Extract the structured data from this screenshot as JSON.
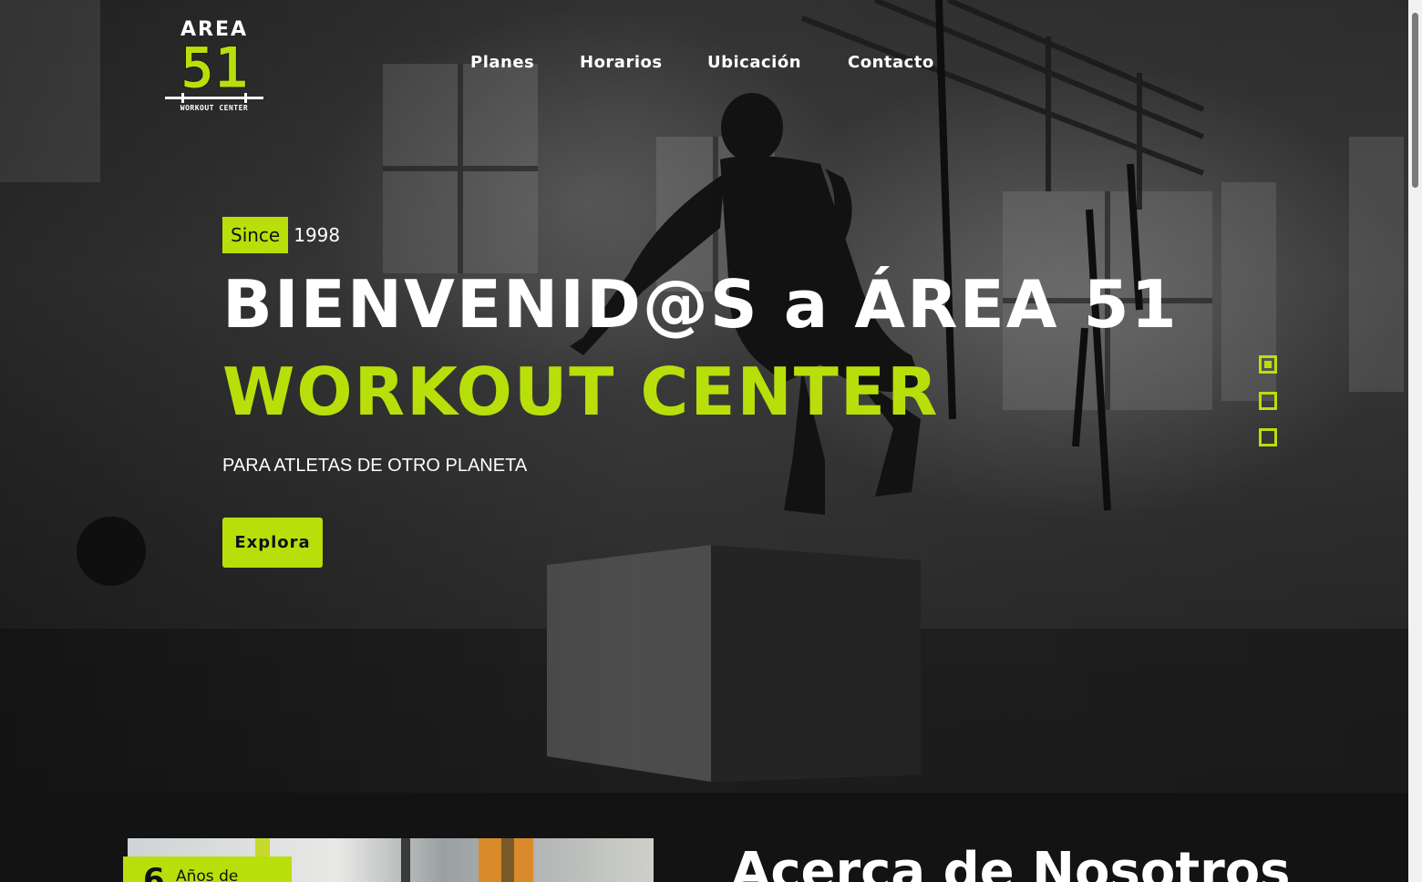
{
  "brand": {
    "logo_top": "AREA",
    "logo_number": "51",
    "logo_sub": "WORKOUT CENTER"
  },
  "nav": {
    "items": [
      "Planes",
      "Horarios",
      "Ubicación",
      "Contacto"
    ]
  },
  "hero": {
    "since_label": "Since",
    "since_year": "1998",
    "title_line1": "BIENVENID@S a ÁREA 51",
    "title_line2": "WORKOUT CENTER",
    "tagline": "PARA ATLETAS DE OTRO PLANETA",
    "cta_label": "Explora",
    "slides": {
      "count": 3,
      "active_index": 0
    }
  },
  "about": {
    "years_number": "6",
    "years_label": "Años de",
    "title": "Acerca de Nosotros"
  },
  "colors": {
    "accent": "#b9df0b",
    "dark": "#131313",
    "text": "#ffffff"
  }
}
